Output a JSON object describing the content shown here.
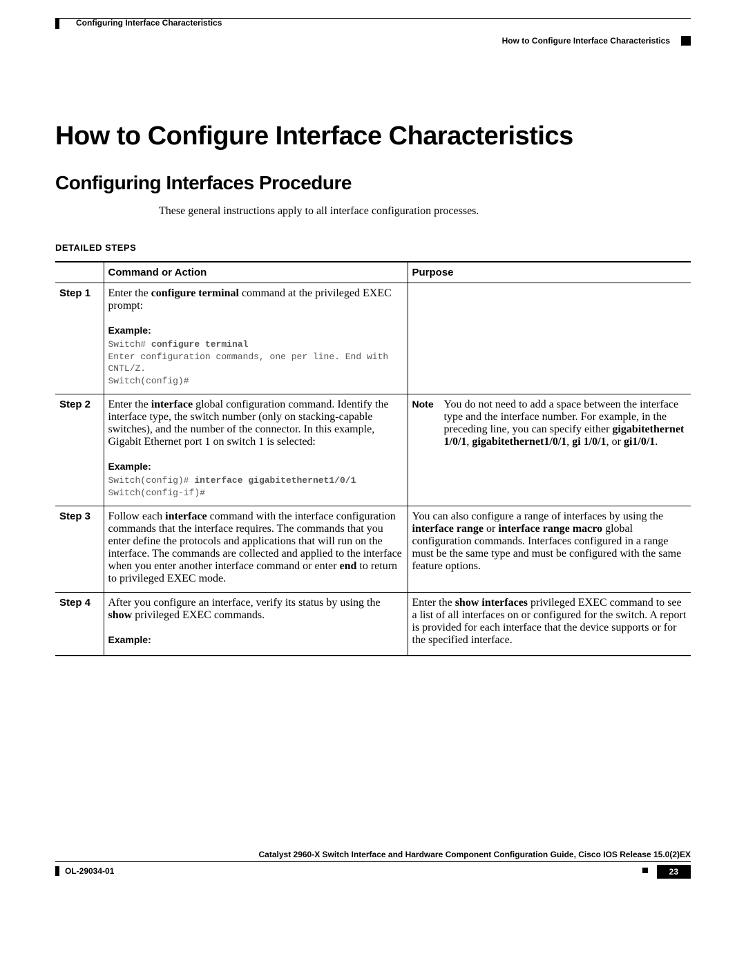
{
  "header": {
    "chapter": "Configuring Interface Characteristics",
    "section": "How to Configure Interface Characteristics"
  },
  "main_heading": "How to Configure Interface Characteristics",
  "section_heading": "Configuring Interfaces Procedure",
  "intro": "These general instructions apply to all interface configuration processes.",
  "detailed_label": "DETAILED STEPS",
  "table": {
    "headers": {
      "col0": "",
      "col1": "Command or Action",
      "col2": "Purpose"
    },
    "rows": [
      {
        "step": "Step 1",
        "command_pre": "Enter the ",
        "command_bold": "configure terminal",
        "command_post": " command at the privileged EXEC prompt:",
        "example_label": "Example:",
        "code_pre": "Switch# ",
        "code_bold": "configure terminal",
        "code_post": "\nEnter configuration commands, one per line. End with\nCNTL/Z.\nSwitch(config)#",
        "purpose": ""
      },
      {
        "step": "Step 2",
        "command_pre": "Enter the ",
        "command_bold": "interface",
        "command_post": " global configuration command. Identify the interface type, the switch number (only on stacking-capable switches), and the number of the connector. In this example, Gigabit Ethernet port 1 on switch 1 is selected:",
        "example_label": "Example:",
        "code_pre": "Switch(config)# ",
        "code_bold": "interface gigabitethernet1/0/1",
        "code_post": "\nSwitch(config-if)#",
        "note_label": "Note",
        "note_pre": "You do not need to add a space between the interface type and the interface number. For example, in the preceding line, you can specify either ",
        "note_b1": "gigabitethernet 1/0/1",
        "note_mid1": ", ",
        "note_b2": "gigabitethernet1/0/1",
        "note_mid2": ", ",
        "note_b3": "gi 1/0/1",
        "note_mid3": ", or ",
        "note_b4": "gi1/0/1",
        "note_post": "."
      },
      {
        "step": "Step 3",
        "command_pre1": "Follow each ",
        "command_bold1": "interface",
        "command_mid1": " command with the interface configuration commands that the interface requires. The commands that you enter define the protocols and applications that will run on the interface. The commands are collected and applied to the interface when you enter another interface command or enter ",
        "command_bold2": "end",
        "command_post1": " to return to privileged EXEC mode.",
        "purpose_pre": "You can also configure a range of interfaces by using the ",
        "purpose_b1": "interface range",
        "purpose_mid1": " or ",
        "purpose_b2": "interface range macro",
        "purpose_post": " global configuration commands. Interfaces configured in a range must be the same type and must be configured with the same feature options."
      },
      {
        "step": "Step 4",
        "command_pre": "After you configure an interface, verify its status by using the ",
        "command_bold": "show",
        "command_post": " privileged EXEC commands.",
        "example_label": "Example:",
        "purpose_pre": "Enter the ",
        "purpose_b1": "show interfaces",
        "purpose_post": " privileged EXEC command to see a list of all interfaces on or configured for the switch. A report is provided for each interface that the device supports or for the specified interface."
      }
    ]
  },
  "footer": {
    "guide": "Catalyst 2960-X Switch Interface and Hardware Component Configuration Guide, Cisco IOS Release 15.0(2)EX",
    "doc": "OL-29034-01",
    "page": "23"
  }
}
